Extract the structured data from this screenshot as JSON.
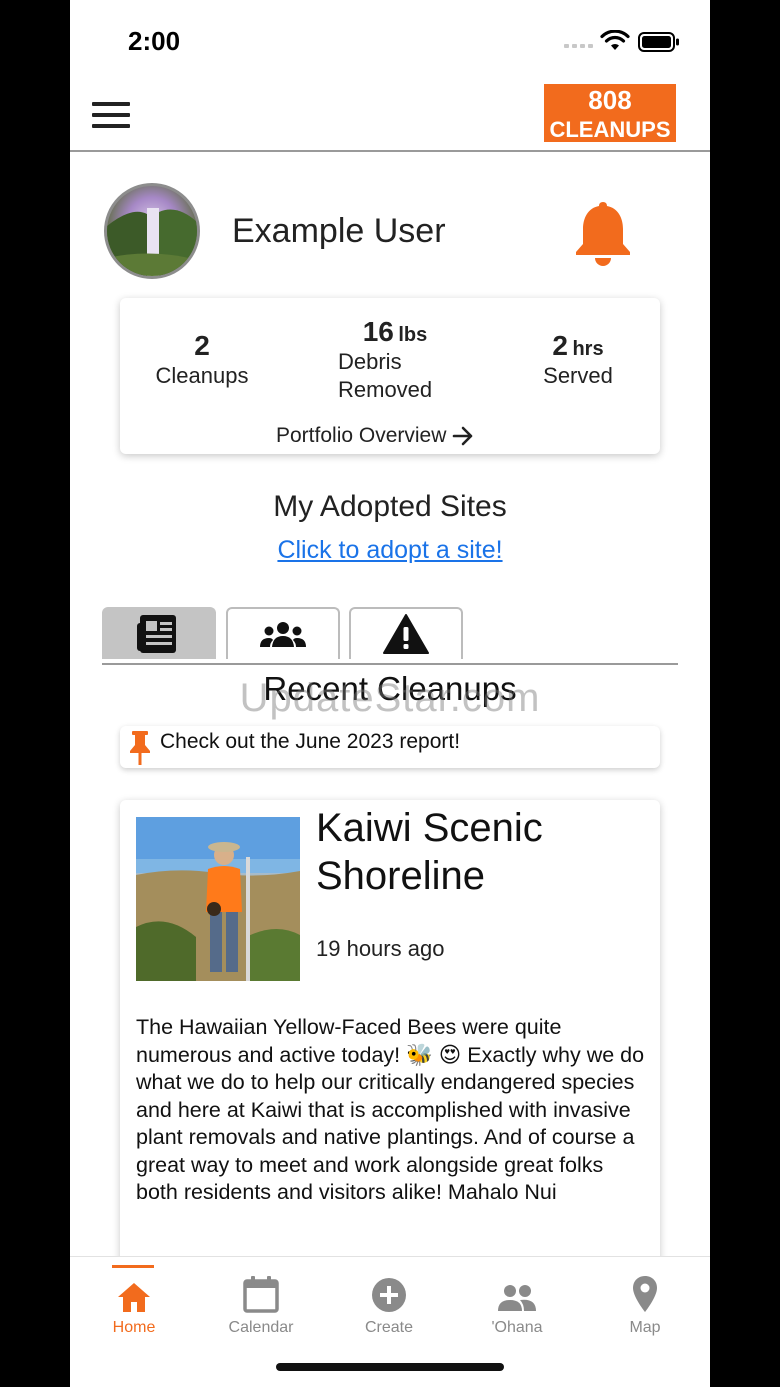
{
  "status_bar": {
    "time": "2:00"
  },
  "header": {
    "logo_top": "808",
    "logo_bottom": "CLEANUPS"
  },
  "profile": {
    "name": "Example User"
  },
  "stats": {
    "cleanups_value": "2",
    "cleanups_label": "Cleanups",
    "debris_value": "16",
    "debris_unit": "lbs",
    "debris_label_1": "Debris",
    "debris_label_2": "Removed",
    "hours_value": "2",
    "hours_unit": "hrs",
    "hours_label": "Served",
    "portfolio_link": "Portfolio Overview"
  },
  "adopted": {
    "title": "My Adopted Sites",
    "link": "Click to adopt a site!"
  },
  "tabs": [
    {
      "icon": "newspaper-icon",
      "active": true
    },
    {
      "icon": "group-icon",
      "active": false
    },
    {
      "icon": "warning-icon",
      "active": false
    }
  ],
  "section_title": "Recent Cleanups",
  "watermark": "UpdateStar.com",
  "report_banner": "Check out the June 2023 report!",
  "post": {
    "title": "Kaiwi Scenic Shoreline",
    "time": "19 hours ago",
    "body": "The Hawaiian Yellow-Faced Bees were quite numerous and active today! 🐝 😍 Exactly why we do what we do to help our critically endangered species and here at Kaiwi that is accomplished with invasive plant removals and native plantings. And of course a great way to meet and work alongside great folks both residents and visitors alike! Mahalo Nui"
  },
  "bottom_nav": {
    "home": "Home",
    "calendar": "Calendar",
    "create": "Create",
    "ohana": "'Ohana",
    "map": "Map"
  },
  "colors": {
    "accent": "#f26b1d",
    "link": "#1a73e8"
  }
}
